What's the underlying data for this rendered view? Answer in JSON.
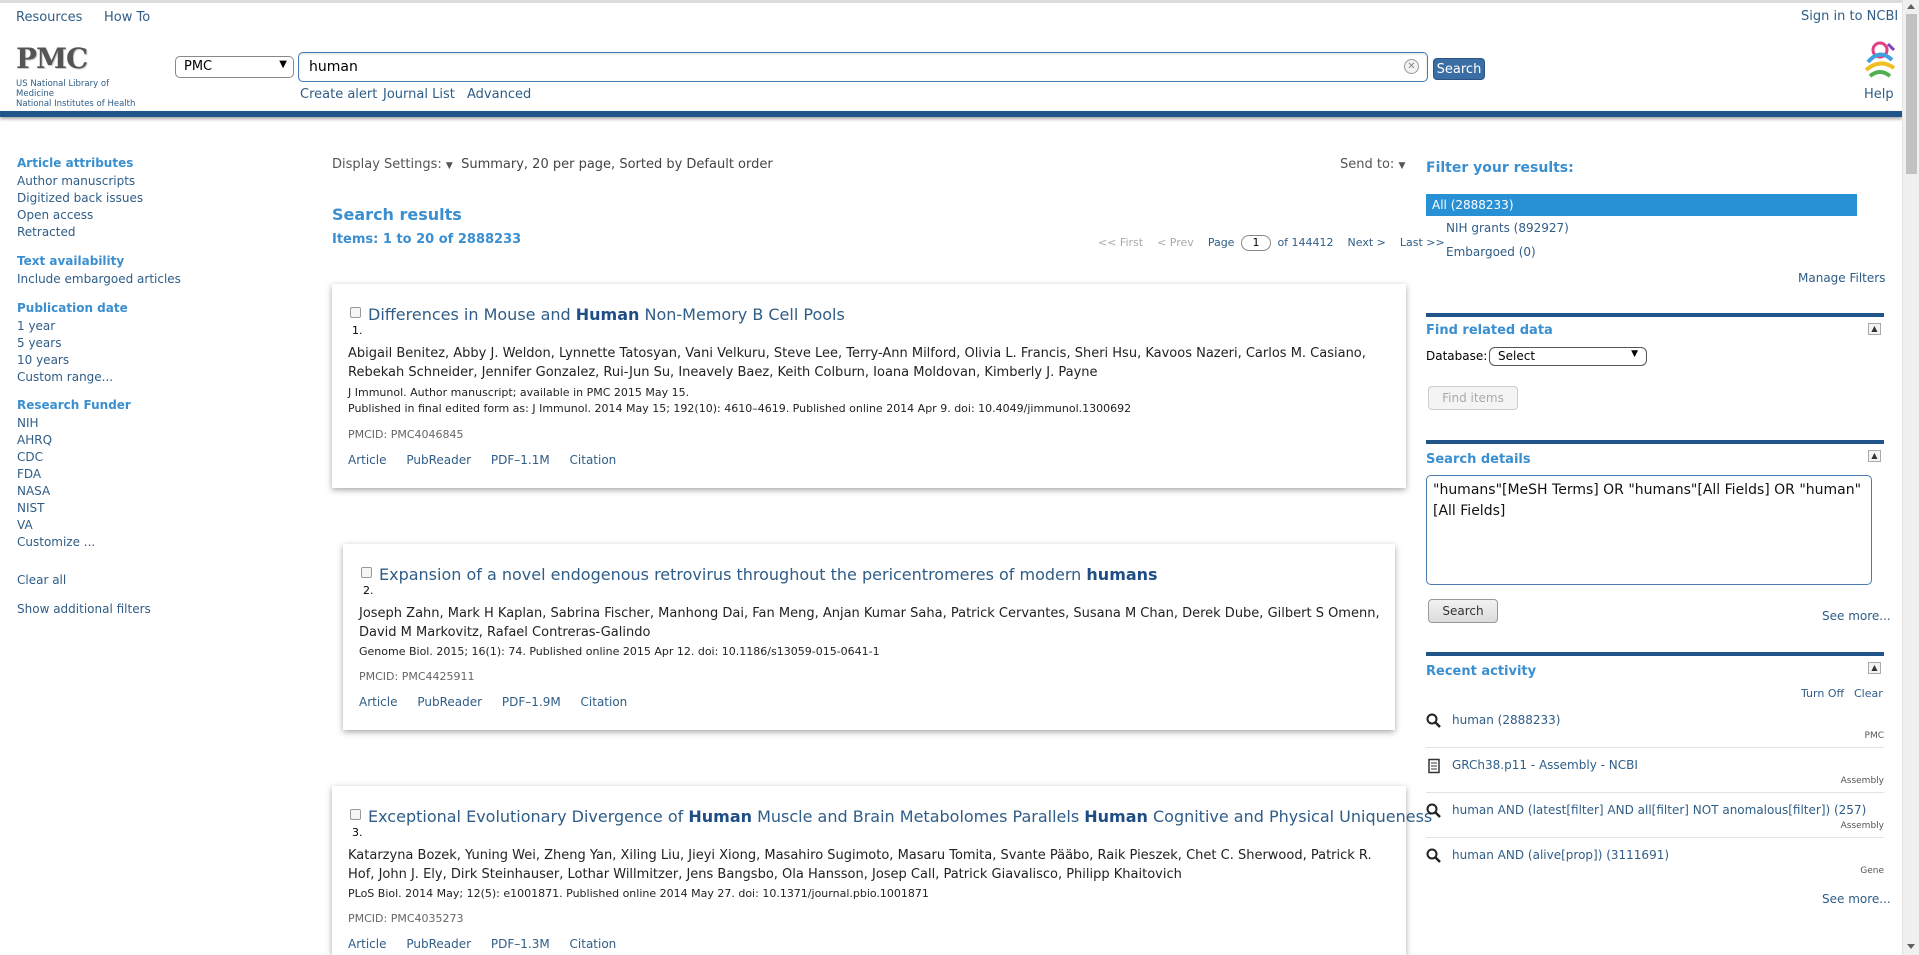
{
  "header": {
    "top_links": [
      "Resources",
      "How To"
    ],
    "sign_in": "Sign in to NCBI",
    "logo_word": "PMC",
    "logo_sub": [
      "US National Library of Medicine",
      "National Institutes of Health"
    ],
    "db_selected": "PMC",
    "search_value": "human",
    "search_button": "Search",
    "sub_links": [
      "Create alert",
      "Journal List",
      "Advanced"
    ],
    "help": "Help"
  },
  "sidebar": {
    "groups": [
      {
        "heading": "Article attributes",
        "items": [
          "Author manuscripts",
          "Digitized back issues",
          "Open access",
          "Retracted"
        ]
      },
      {
        "heading": "Text availability",
        "items": [
          "Include embargoed articles"
        ]
      },
      {
        "heading": "Publication date",
        "items": [
          "1 year",
          "5 years",
          "10 years",
          "Custom range..."
        ]
      },
      {
        "heading": "Research Funder",
        "items": [
          "NIH",
          "AHRQ",
          "CDC",
          "FDA",
          "NASA",
          "NIST",
          "VA",
          "Customize ..."
        ]
      }
    ],
    "clear_all": "Clear all",
    "show_additional": "Show additional filters"
  },
  "results": {
    "display_settings_label": "Display Settings:",
    "display_settings_value": "Summary, 20 per page, Sorted by Default order",
    "send_to": "Send to:",
    "title": "Search results",
    "items_count": "Items: 1 to 20 of 2888233",
    "pager": {
      "first": "<< First",
      "prev": "< Prev",
      "page_label": "Page",
      "page": "1",
      "of": "of 144412",
      "next": "Next >",
      "last": "Last >>"
    },
    "items": [
      {
        "num": "1.",
        "title_parts": [
          "Differences in Mouse and ",
          "Human",
          " Non-Memory B Cell Pools"
        ],
        "authors": "Abigail Benitez, Abby J. Weldon, Lynnette Tatosyan, Vani Velkuru, Steve Lee, Terry-Ann Milford, Olivia L. Francis, Sheri Hsu, Kavoos Nazeri, Carlos M. Casiano, Rebekah Schneider, Jennifer Gonzalez, Rui-Jun Su, Ineavely Baez, Keith Colburn, Ioana Moldovan, Kimberly J. Payne",
        "journal_lines": [
          "J Immunol. Author manuscript; available in PMC 2015 May 15.",
          "Published in final edited form as: J Immunol. 2014 May 15; 192(10): 4610–4619. Published online 2014 Apr 9. doi: 10.4049/jimmunol.1300692"
        ],
        "pmcid": "PMCID: PMC4046845",
        "links": [
          "Article",
          "PubReader",
          "PDF–1.1M",
          "Citation"
        ]
      },
      {
        "num": "2.",
        "title_parts": [
          "Expansion of a novel endogenous retrovirus throughout the pericentromeres of modern ",
          "humans",
          ""
        ],
        "authors": "Joseph Zahn, Mark H Kaplan, Sabrina Fischer, Manhong Dai, Fan Meng, Anjan Kumar Saha, Patrick Cervantes, Susana M Chan, Derek Dube, Gilbert S Omenn, David M Markovitz, Rafael Contreras-Galindo",
        "journal_lines": [
          "Genome Biol. 2015; 16(1): 74. Published online 2015 Apr 12. doi: 10.1186/s13059-015-0641-1"
        ],
        "pmcid": "PMCID: PMC4425911",
        "links": [
          "Article",
          "PubReader",
          "PDF–1.9M",
          "Citation"
        ]
      },
      {
        "num": "3.",
        "title_parts": [
          "Exceptional Evolutionary Divergence of ",
          "Human",
          " Muscle and Brain Metabolomes Parallels ",
          "Human",
          " Cognitive and Physical Uniqueness"
        ],
        "authors": "Katarzyna Bozek, Yuning Wei, Zheng Yan, Xiling Liu, Jieyi Xiong, Masahiro Sugimoto, Masaru Tomita, Svante Pääbo, Raik Pieszek, Chet C. Sherwood, Patrick R. Hof, John J. Ely, Dirk Steinhauser, Lothar Willmitzer, Jens Bangsbo, Ola Hansson, Josep Call, Patrick Giavalisco, Philipp Khaitovich",
        "journal_lines": [
          "PLoS Biol. 2014 May; 12(5): e1001871. Published online 2014 May 27. doi: 10.1371/journal.pbio.1001871"
        ],
        "pmcid": "PMCID: PMC4035273",
        "links": [
          "Article",
          "PubReader",
          "PDF–1.3M",
          "Citation"
        ]
      }
    ]
  },
  "right": {
    "filter_title": "Filter your results:",
    "filters": [
      "All (2888233)",
      "NIH grants (892927)",
      "Embargoed (0)"
    ],
    "manage_filters": "Manage Filters",
    "related_title": "Find related data",
    "database_label": "Database:",
    "database_value": "Select",
    "find_items": "Find items",
    "details_title": "Search details",
    "details_text": "\"humans\"[MeSH Terms] OR \"humans\"[All Fields] OR \"human\"[All Fields]",
    "details_search": "Search",
    "see_more": "See more...",
    "recent_title": "Recent activity",
    "turn_off": "Turn Off",
    "clear": "Clear",
    "recent": [
      {
        "icon": "search-icon",
        "text": "human (2888233)",
        "db": "PMC"
      },
      {
        "icon": "document-icon",
        "text": "GRCh38.p11 - Assembly - NCBI",
        "db": "Assembly"
      },
      {
        "icon": "search-icon",
        "text": "human AND (latest[filter] AND all[filter] NOT anomalous[filter]) (257)",
        "db": "Assembly"
      },
      {
        "icon": "search-icon",
        "text": "human AND (alive[prop]) (3111691)",
        "db": "Gene"
      }
    ],
    "recent_see_more": "See more..."
  },
  "colors": {
    "accent": "#3a8fd0",
    "header_bar": "#20558a",
    "link": "#2f5d87",
    "selected_filter": "#2891d6"
  }
}
